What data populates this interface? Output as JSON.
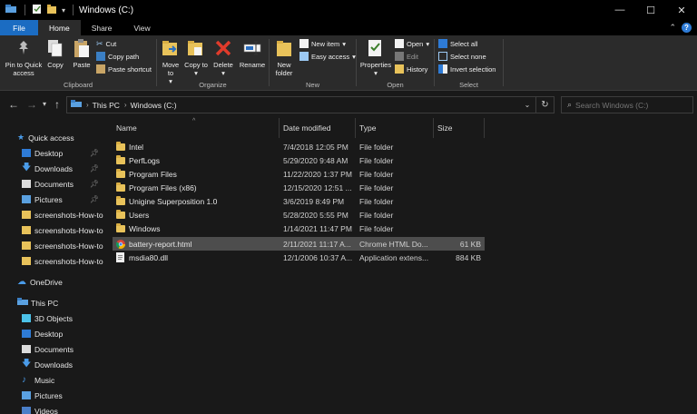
{
  "window": {
    "title": "Windows (C:)",
    "controls": {
      "minimize": "—",
      "maximize": "☐",
      "close": "✕"
    }
  },
  "tabs": [
    {
      "label": "File"
    },
    {
      "label": "Home"
    },
    {
      "label": "Share"
    },
    {
      "label": "View"
    }
  ],
  "ribbon": {
    "clipboard": {
      "label": "Clipboard",
      "pin_label": "Pin to Quick access",
      "copy_label": "Copy",
      "paste_label": "Paste",
      "cut_label": "Cut",
      "copy_path_label": "Copy path",
      "paste_shortcut_label": "Paste shortcut"
    },
    "organize": {
      "label": "Organize",
      "move_to_label": "Move to",
      "copy_to_label": "Copy to",
      "delete_label": "Delete",
      "rename_label": "Rename"
    },
    "new": {
      "label": "New",
      "new_folder_label": "New folder",
      "new_item_label": "New item",
      "easy_access_label": "Easy access"
    },
    "open": {
      "label": "Open",
      "properties_label": "Properties",
      "open_label": "Open",
      "edit_label": "Edit",
      "history_label": "History"
    },
    "select": {
      "label": "Select",
      "select_all_label": "Select all",
      "select_none_label": "Select none",
      "invert_selection_label": "Invert selection"
    }
  },
  "address": {
    "breadcrumb": [
      "This PC",
      "Windows (C:)"
    ],
    "search_placeholder": "Search Windows (C:)"
  },
  "navpane": {
    "quick_access": "Quick access",
    "items": [
      {
        "label": "Desktop",
        "pinned": true
      },
      {
        "label": "Downloads",
        "pinned": true
      },
      {
        "label": "Documents",
        "pinned": true
      },
      {
        "label": "Pictures",
        "pinned": true
      },
      {
        "label": "screenshots-How-to",
        "pinned": false
      },
      {
        "label": "screenshots-How-to",
        "pinned": false
      },
      {
        "label": "screenshots-How-to",
        "pinned": false
      },
      {
        "label": "screenshots-How-to",
        "pinned": false
      }
    ],
    "onedrive": "OneDrive",
    "this_pc": "This PC",
    "pc_items": [
      "3D Objects",
      "Desktop",
      "Documents",
      "Downloads",
      "Music",
      "Pictures",
      "Videos"
    ]
  },
  "columns": {
    "name": "Name",
    "date": "Date modified",
    "type": "Type",
    "size": "Size"
  },
  "files": [
    {
      "name": "Intel",
      "date": "7/4/2018 12:05 PM",
      "type": "File folder",
      "size": ""
    },
    {
      "name": "PerfLogs",
      "date": "5/29/2020 9:48 AM",
      "type": "File folder",
      "size": ""
    },
    {
      "name": "Program Files",
      "date": "11/22/2020 1:37 PM",
      "type": "File folder",
      "size": ""
    },
    {
      "name": "Program Files (x86)",
      "date": "12/15/2020 12:51 ...",
      "type": "File folder",
      "size": ""
    },
    {
      "name": "Unigine Superposition 1.0",
      "date": "3/6/2019 8:49 PM",
      "type": "File folder",
      "size": ""
    },
    {
      "name": "Users",
      "date": "5/28/2020 5:55 PM",
      "type": "File folder",
      "size": ""
    },
    {
      "name": "Windows",
      "date": "1/14/2021 11:47 PM",
      "type": "File folder",
      "size": ""
    },
    {
      "name": "battery-report.html",
      "date": "2/11/2021 11:17 A...",
      "type": "Chrome HTML Do...",
      "size": "61 KB"
    },
    {
      "name": "msdia80.dll",
      "date": "12/1/2006 10:37 A...",
      "type": "Application extens...",
      "size": "884 KB"
    }
  ],
  "colors": {
    "accent": "#1b6cc2",
    "folder": "#e8c25a",
    "selected_row": "#4d4d4d",
    "background": "#191919",
    "ribbon": "#2b2b2b"
  }
}
